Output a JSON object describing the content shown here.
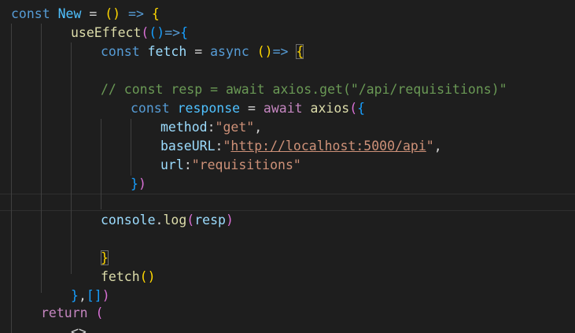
{
  "editor": {
    "lines": {
      "l1": {
        "kw": "const",
        "name": "New",
        "eq": " = ",
        "paren": "()",
        "arrow": " => ",
        "brace": "{"
      },
      "l2": {
        "fn": "useEffect",
        "open1": "(",
        "open2": "()",
        "arrow": "=>",
        "brace": "{"
      },
      "l3": {
        "kw": "const",
        "name": "fetch",
        "eq": " = ",
        "async": "async",
        "paren": "()",
        "arrow": "=>",
        "brace": "{"
      },
      "l5": {
        "comment": "// const resp = await axios.get(\"/api/requisitions)\""
      },
      "l6": {
        "kw": "const",
        "name": "response",
        "eq": " = ",
        "await": "await",
        "fn": "axios",
        "open": "(",
        "brace": "{"
      },
      "l7": {
        "key": "method",
        "colon": ":",
        "value": "\"get\"",
        "comma": ","
      },
      "l8": {
        "key": "baseURL",
        "colon": ":",
        "q1": "\"",
        "url": "http://localhost:5000/api",
        "q2": "\"",
        "comma": ","
      },
      "l9": {
        "key": "url",
        "colon": ":",
        "value": "\"requisitions\""
      },
      "l10": {
        "brace": "}",
        "paren": ")"
      },
      "l12": {
        "obj": "console",
        "dot": ".",
        "fn": "log",
        "open": "(",
        "arg": "resp",
        "close": ")"
      },
      "l14": {
        "brace": "}"
      },
      "l15": {
        "fn": "fetch",
        "paren": "()"
      },
      "l16": {
        "brace": "}",
        "comma": ",",
        "arr": "[]",
        "paren": ")"
      },
      "l17": {
        "kw": "return",
        "paren": "("
      },
      "l18": {
        "tag": "<>"
      }
    }
  }
}
